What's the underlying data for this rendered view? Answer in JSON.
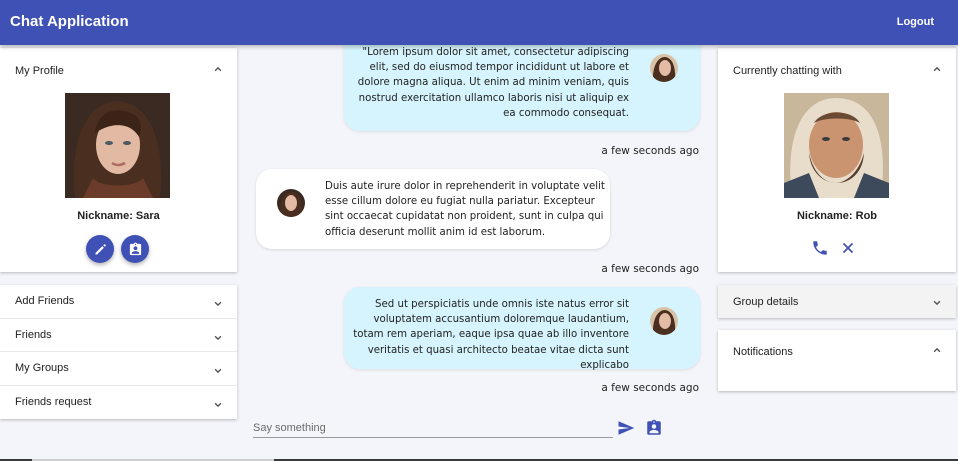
{
  "app": {
    "title": "Chat Application",
    "logout_label": "Logout"
  },
  "profile": {
    "heading": "My Profile",
    "nickname": "Nickname: Sara"
  },
  "menu": [
    {
      "label": "Add Friends"
    },
    {
      "label": "Friends"
    },
    {
      "label": "My Groups"
    },
    {
      "label": "Friends request"
    }
  ],
  "messages": [
    {
      "from": "me",
      "text": "\"Lorem ipsum dolor sit amet, consectetur adipiscing elit, sed do eiusmod tempor incididunt ut labore et dolore magna aliqua. Ut enim ad minim veniam, quis nostrud exercitation ullamco laboris nisi ut aliquip ex ea commodo consequat.",
      "time": "a few seconds ago"
    },
    {
      "from": "them",
      "text": "Duis aute irure dolor in reprehenderit in voluptate velit esse cillum dolore eu fugiat nulla pariatur. Excepteur sint occaecat cupidatat non proident, sunt in culpa qui officia deserunt mollit anim id est laborum.",
      "time": "a few seconds ago"
    },
    {
      "from": "me",
      "text": "Sed ut perspiciatis unde omnis iste natus error sit voluptatem accusantium doloremque laudantium, totam rem aperiam, eaque ipsa quae ab illo inventore veritatis et quasi architecto beatae vitae dicta sunt explicabo",
      "time": "a few seconds ago"
    }
  ],
  "composer": {
    "placeholder": "Say something"
  },
  "chatting": {
    "heading": "Currently chatting with",
    "nickname": "Nickname: Rob"
  },
  "group_details": {
    "heading": "Group details"
  },
  "notifications": {
    "heading": "Notifications"
  },
  "colors": {
    "primary": "#3f51b5",
    "my_bubble": "#d6f4fd",
    "their_bubble": "#ffffff",
    "background": "#f4f5fa"
  },
  "icons": [
    "chevron-up-icon",
    "chevron-down-icon",
    "edit-icon",
    "contact-card-icon",
    "send-icon",
    "phone-icon",
    "close-icon"
  ]
}
